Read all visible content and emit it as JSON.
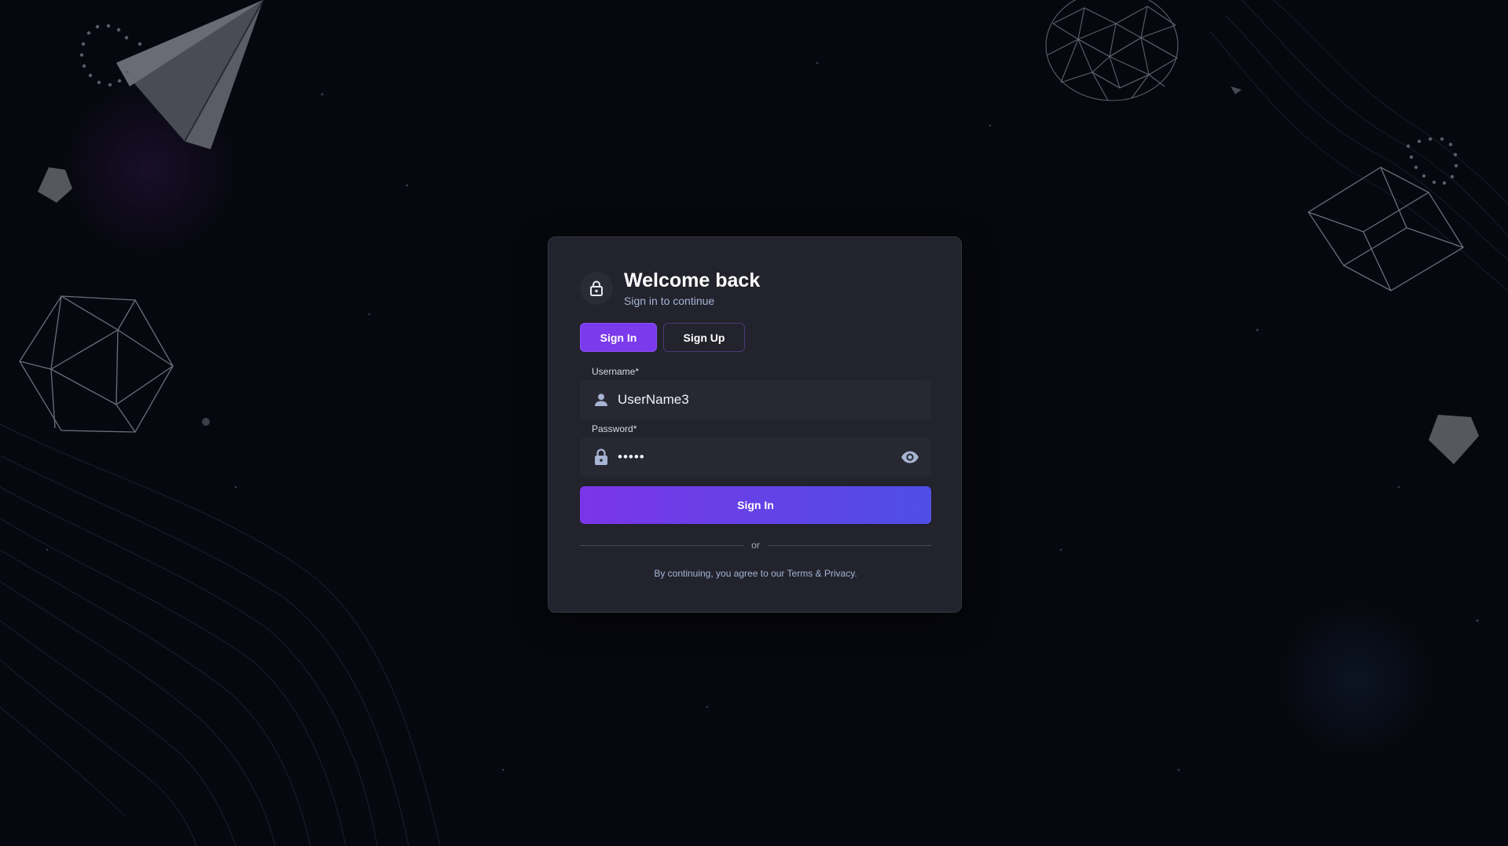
{
  "header": {
    "title": "Welcome back",
    "subtitle": "Sign in to continue",
    "icon": "lock-icon"
  },
  "tabs": [
    {
      "label": "Sign In",
      "active": true
    },
    {
      "label": "Sign Up",
      "active": false
    }
  ],
  "form": {
    "username": {
      "label": "Username",
      "required_marker": "*",
      "value": "UserName3",
      "icon": "person-icon"
    },
    "password": {
      "label": "Password",
      "required_marker": "*",
      "value": "•••••",
      "icon": "lock-icon",
      "toggle_icon": "eye-icon"
    },
    "submit_label": "Sign In"
  },
  "divider_text": "or",
  "footer": {
    "prefix": "By continuing, you agree to our ",
    "terms": "Terms",
    "and": " & ",
    "privacy": "Privacy",
    "suffix": "."
  },
  "colors": {
    "accent": "#7c3aed",
    "accent_end": "#4f4ee6",
    "card": "#22232c",
    "background": "#07080f",
    "muted_text": "#a6b4d6"
  }
}
